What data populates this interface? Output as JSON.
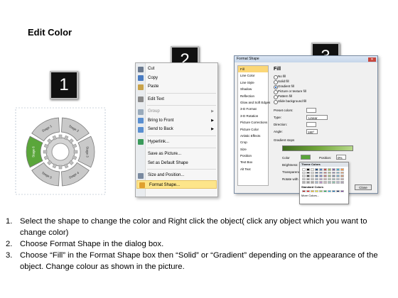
{
  "title": "Edit Color",
  "badges": [
    "1",
    "2",
    "3"
  ],
  "diagram": {
    "stages": [
      "Stage 1",
      "Stage 2",
      "Stage 3",
      "Stage 4",
      "Stage 5",
      "Stage 6"
    ],
    "highlight_color": "#5aa63a",
    "ring_color": "#c9c9c9"
  },
  "context_menu": {
    "items": [
      {
        "label": "Cut",
        "icon": "scissors-icon",
        "disabled": false,
        "submenu": false
      },
      {
        "label": "Copy",
        "icon": "copy-icon",
        "disabled": false,
        "submenu": false
      },
      {
        "label": "Paste",
        "icon": "paste-icon",
        "disabled": false,
        "submenu": false
      },
      {
        "label": "Edit Text",
        "icon": "edit-text-icon",
        "disabled": false,
        "submenu": false
      },
      {
        "label": "Group",
        "icon": "group-icon",
        "disabled": true,
        "submenu": true
      },
      {
        "label": "Bring to Front",
        "icon": "bring-front-icon",
        "disabled": false,
        "submenu": true
      },
      {
        "label": "Send to Back",
        "icon": "send-back-icon",
        "disabled": false,
        "submenu": true
      },
      {
        "label": "Hyperlink...",
        "icon": "hyperlink-icon",
        "disabled": false,
        "submenu": false
      },
      {
        "label": "Save as Picture...",
        "icon": "",
        "disabled": false,
        "submenu": false
      },
      {
        "label": "Set as Default Shape",
        "icon": "",
        "disabled": false,
        "submenu": false
      },
      {
        "label": "Size and Position...",
        "icon": "size-position-icon",
        "disabled": false,
        "submenu": false
      },
      {
        "label": "Format Shape...",
        "icon": "format-shape-icon",
        "disabled": false,
        "submenu": false
      }
    ]
  },
  "dialog": {
    "title": "Format Shape",
    "nav": [
      "Fill",
      "Line Color",
      "Line Style",
      "Shadow",
      "Reflection",
      "Glow and Soft Edges",
      "3-D Format",
      "3-D Rotation",
      "Picture Corrections",
      "Picture Color",
      "Artistic Effects",
      "Crop",
      "Size",
      "Position",
      "Text Box",
      "Alt Text"
    ],
    "section": "Fill",
    "fill_options": [
      "No fill",
      "Solid fill",
      "Gradient fill",
      "Picture or texture fill",
      "Pattern fill",
      "Slide background fill"
    ],
    "preset_label": "Preset colors:",
    "type_label": "Type:",
    "type_value": "Linear",
    "direction_label": "Direction:",
    "angle_label": "Angle:",
    "angle_value": "180°",
    "stops_label": "Gradient stops",
    "color_label": "Color",
    "position_label": "Position:",
    "position_value": "0%",
    "brightness_label": "Brightness:",
    "transparency_label": "Transparency:",
    "rotate_label": "Rotate with shape",
    "close_label": "Close"
  },
  "picker": {
    "theme_label": "Theme Colors",
    "standard_label": "Standard Colors",
    "more_label": "More Colors..."
  },
  "steps": [
    {
      "num": "1.",
      "text": "Select the shape to change the color and Right click the object( click any object which you want to change color)"
    },
    {
      "num": "2.",
      "text": "Choose Format Shape in the dialog box."
    },
    {
      "num": "3.",
      "text": "Choose “Fill” in the Format Shape box then “Solid” or “Gradient” depending on the appearance of the object. Change colour as shown in the picture."
    }
  ]
}
